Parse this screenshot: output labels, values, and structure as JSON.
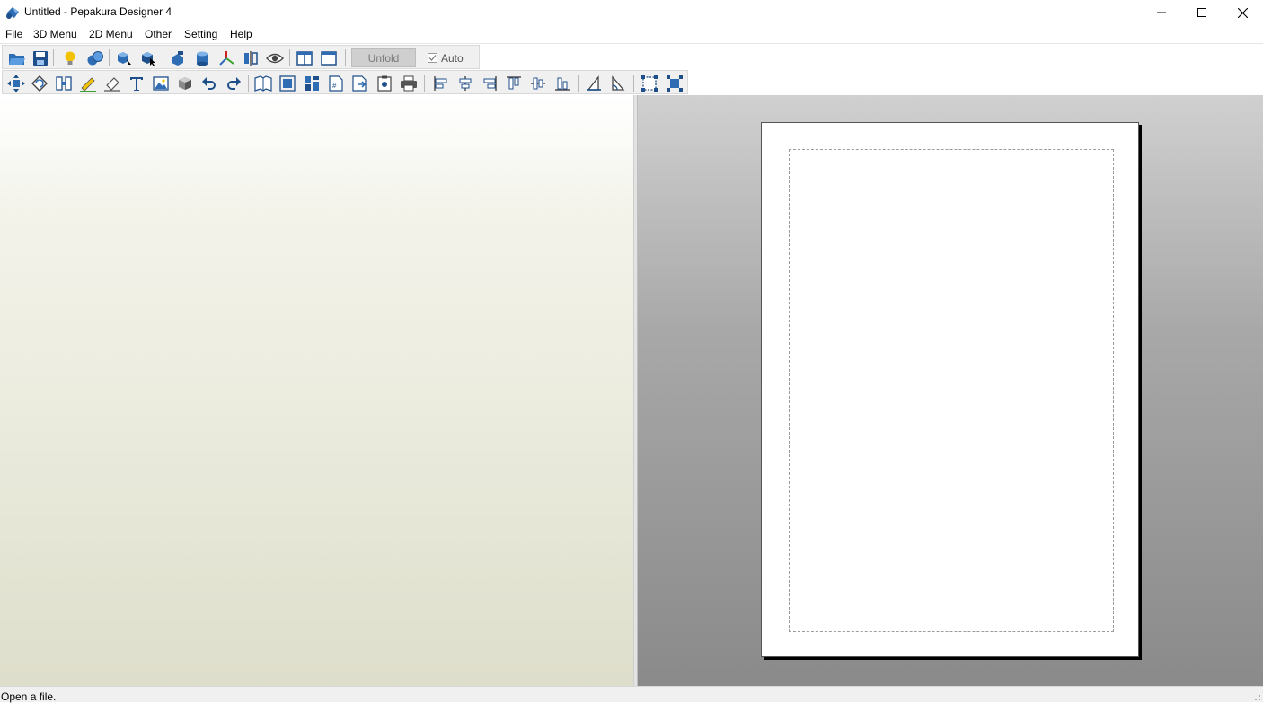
{
  "window": {
    "title": "Untitled - Pepakura Designer 4",
    "minimize_icon": "minimize-icon",
    "maximize_icon": "maximize-icon",
    "close_icon": "close-icon"
  },
  "menu": {
    "items": [
      {
        "label": "File"
      },
      {
        "label": "3D Menu"
      },
      {
        "label": "2D Menu"
      },
      {
        "label": "Other"
      },
      {
        "label": "Setting"
      },
      {
        "label": "Help"
      }
    ]
  },
  "toolbar": {
    "unfold_label": "Unfold",
    "auto_label": "Auto",
    "auto_checked": true
  },
  "status": {
    "text": "Open a file."
  },
  "colors": {
    "icon_blue": "#2e6db4",
    "icon_dark": "#2a4f7a",
    "icon_yellow": "#f2c200",
    "icon_green": "#3aa030",
    "icon_red": "#d02020",
    "paper_bg": "#ffffff",
    "pane_3d_bottom": "#dedecb"
  }
}
